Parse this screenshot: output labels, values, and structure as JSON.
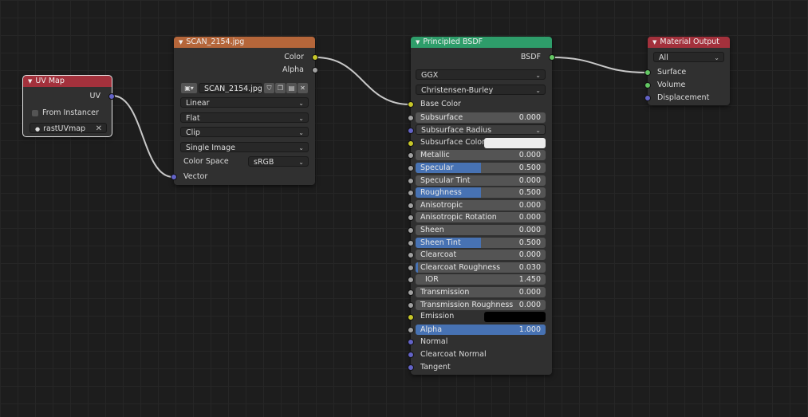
{
  "uv_map": {
    "title": "UV Map",
    "output_uv": "UV",
    "from_instancer": "From Instancer",
    "uv_map_name": "rastUVmap"
  },
  "image_texture": {
    "title": "SCAN_2154.jpg",
    "out_color": "Color",
    "out_alpha": "Alpha",
    "image_name": "SCAN_2154.jpg",
    "interpolation": "Linear",
    "projection": "Flat",
    "extension": "Clip",
    "source": "Single Image",
    "color_space_label": "Color Space",
    "color_space_value": "sRGB",
    "in_vector": "Vector"
  },
  "bsdf": {
    "title": "Principled BSDF",
    "out_bsdf": "BSDF",
    "distribution": "GGX",
    "subsurface_method": "Christensen-Burley",
    "base_color": "Base Color",
    "subsurface": {
      "label": "Subsurface",
      "value": "0.000"
    },
    "subsurface_radius": "Subsurface Radius",
    "subsurface_color": "Subsurface Color",
    "metallic": {
      "label": "Metallic",
      "value": "0.000"
    },
    "specular": {
      "label": "Specular",
      "value": "0.500",
      "fill": 0.5
    },
    "specular_tint": {
      "label": "Specular Tint",
      "value": "0.000"
    },
    "roughness": {
      "label": "Roughness",
      "value": "0.500",
      "fill": 0.5
    },
    "anisotropic": {
      "label": "Anisotropic",
      "value": "0.000"
    },
    "anisotropic_rotation": {
      "label": "Anisotropic Rotation",
      "value": "0.000"
    },
    "sheen": {
      "label": "Sheen",
      "value": "0.000"
    },
    "sheen_tint": {
      "label": "Sheen Tint",
      "value": "0.500",
      "fill": 0.5
    },
    "clearcoat": {
      "label": "Clearcoat",
      "value": "0.000"
    },
    "clearcoat_roughness": {
      "label": "Clearcoat Roughness",
      "value": "0.030",
      "fill": 0.03
    },
    "ior": {
      "label": "IOR",
      "value": "1.450"
    },
    "transmission": {
      "label": "Transmission",
      "value": "0.000"
    },
    "transmission_roughness": {
      "label": "Transmission Roughness",
      "value": "0.000"
    },
    "emission": "Emission",
    "alpha": {
      "label": "Alpha",
      "value": "1.000",
      "fill": 1.0
    },
    "normal": "Normal",
    "clearcoat_normal": "Clearcoat Normal",
    "tangent": "Tangent"
  },
  "material_output": {
    "title": "Material Output",
    "target": "All",
    "surface": "Surface",
    "volume": "Volume",
    "displacement": "Displacement"
  },
  "colors": {
    "header_input": "#a3313c",
    "header_texture": "#b5663a",
    "header_shader": "#2e9d6a",
    "header_output": "#a3313c",
    "field_fill": "#4772b3",
    "subsurface_color_swatch": "#ececec",
    "emission_swatch": "#000000"
  }
}
